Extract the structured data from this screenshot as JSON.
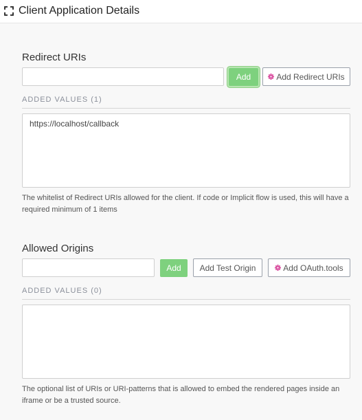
{
  "header": {
    "title": "Client Application Details",
    "icon": "expand-icon"
  },
  "colors": {
    "accent_green": "#7ed17e",
    "gear_pink": "#d94c9e"
  },
  "redirect_uris": {
    "title": "Redirect URIs",
    "input_value": "",
    "add_label": "Add",
    "add_redirect_label": "Add Redirect URIs",
    "added_values_label": "ADDED VALUES (1)",
    "values": [
      "https://localhost/callback"
    ],
    "help": "The whitelist of Redirect URIs allowed for the client. If code or Implicit flow is used, this will have a required minimum of 1 items"
  },
  "allowed_origins": {
    "title": "Allowed Origins",
    "input_value": "",
    "add_label": "Add",
    "add_test_origin_label": "Add Test Origin",
    "add_oauth_tools_label": "Add OAuth.tools",
    "added_values_label": "ADDED VALUES (0)",
    "values": [],
    "help": "The optional list of URIs or URI-patterns that is allowed to embed the rendered pages inside an iframe or be a trusted source."
  }
}
